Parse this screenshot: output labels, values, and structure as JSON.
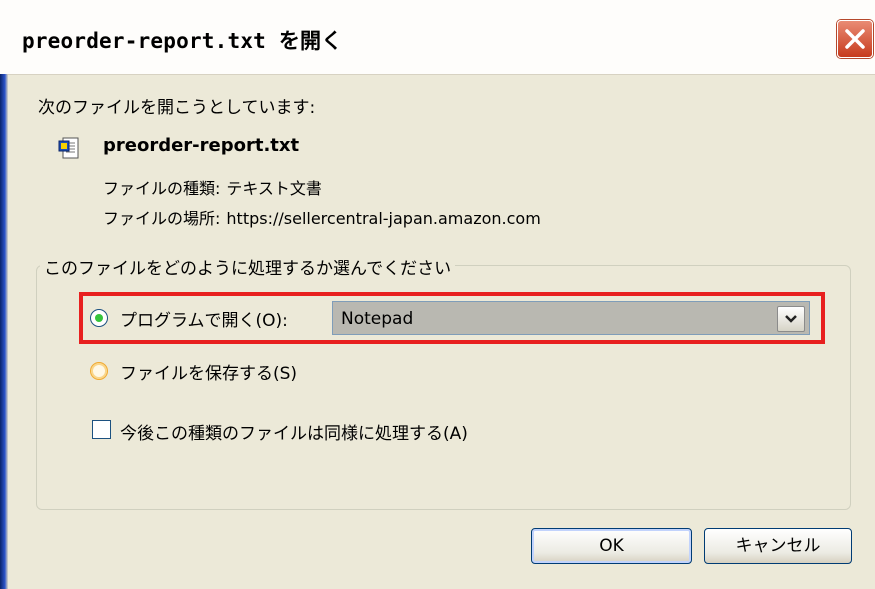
{
  "window": {
    "title": "preorder-report.txt を開く"
  },
  "dialog": {
    "prompt": "次のファイルを開こうとしています:",
    "file_icon": "text-file-icon",
    "filename": "preorder-report.txt",
    "type_label": "ファイルの種類:",
    "type_value": "テキスト文書",
    "location_label": "ファイルの場所:",
    "location_value": "https://sellercentral-japan.amazon.com"
  },
  "action_group": {
    "legend": "このファイルをどのように処理するか選んでください",
    "open_with_label": "プログラムで開く(O):",
    "open_with_selected": true,
    "program_value": "Notepad",
    "save_file_label": "ファイルを保存する(S)",
    "save_file_selected": false,
    "remember_label": "今後この種類のファイルは同様に処理する(A)",
    "remember_checked": false
  },
  "buttons": {
    "ok": "OK",
    "cancel": "キャンセル"
  },
  "colors": {
    "highlight_border": "#e8201f",
    "dialog_background": "#ece9d8",
    "close_button": "#c73b1d"
  }
}
